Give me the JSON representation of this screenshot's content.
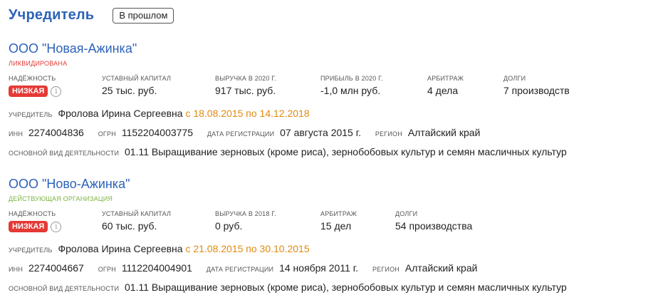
{
  "header": {
    "title": "Учредитель",
    "past_button": "В прошлом"
  },
  "colors": {
    "link": "#2d63b9",
    "liquidated": "#e53935",
    "active": "#7cb342",
    "period": "#e08a10",
    "badge": "#e53935"
  },
  "companies": [
    {
      "name": "ООО \"Новая-Ажинка\"",
      "status": "ЛИКВИДИРОВАНА",
      "metrics": {
        "reliability_label": "НАДЁЖНОСТЬ",
        "reliability_value": "НИЗКАЯ",
        "capital_label": "УСТАВНЫЙ КАПИТАЛ",
        "capital_value": "25 тыс. руб.",
        "revenue_label": "ВЫРУЧКА В 2020 Г.",
        "revenue_value": "917 тыс. руб.",
        "profit_label": "ПРИБЫЛЬ В 2020 Г.",
        "profit_value": "-1,0 млн руб.",
        "arbitration_label": "АРБИТРАЖ",
        "arbitration_value": "4 дела",
        "debts_label": "ДОЛГИ",
        "debts_value": "7 производств"
      },
      "founder_label": "УЧРЕДИТЕЛЬ",
      "founder_name": "Фролова Ирина Сергеевна",
      "founder_period": "с 18.08.2015 по 14.12.2018",
      "inn_label": "ИНН",
      "inn": "2274004836",
      "ogrn_label": "ОГРН",
      "ogrn": "1152204003775",
      "reg_label": "ДАТА РЕГИСТРАЦИИ",
      "reg_date": "07 августа 2015 г.",
      "region_label": "РЕГИОН",
      "region": "Алтайский край",
      "activity_label": "ОСНОВНОЙ ВИД ДЕЯТЕЛЬНОСТИ",
      "activity": "01.11 Выращивание зерновых (кроме риса), зернобобовых культур и семян масличных культур"
    },
    {
      "name": "ООО \"Ново-Ажинка\"",
      "status": "ДЕЙСТВУЮЩАЯ ОРГАНИЗАЦИЯ",
      "metrics": {
        "reliability_label": "НАДЁЖНОСТЬ",
        "reliability_value": "НИЗКАЯ",
        "capital_label": "УСТАВНЫЙ КАПИТАЛ",
        "capital_value": "60 тыс. руб.",
        "revenue_label": "ВЫРУЧКА В 2018 Г.",
        "revenue_value": "0 руб.",
        "arbitration_label": "АРБИТРАЖ",
        "arbitration_value": "15 дел",
        "debts_label": "ДОЛГИ",
        "debts_value": "54 производства"
      },
      "founder_label": "УЧРЕДИТЕЛЬ",
      "founder_name": "Фролова Ирина Сергеевна",
      "founder_period": "с 21.08.2015 по 30.10.2015",
      "inn_label": "ИНН",
      "inn": "2274004667",
      "ogrn_label": "ОГРН",
      "ogrn": "1112204004901",
      "reg_label": "ДАТА РЕГИСТРАЦИИ",
      "reg_date": "14 ноября 2011 г.",
      "region_label": "РЕГИОН",
      "region": "Алтайский край",
      "activity_label": "ОСНОВНОЙ ВИД ДЕЯТЕЛЬНОСТИ",
      "activity": "01.11 Выращивание зерновых (кроме риса), зернобобовых культур и семян масличных культур"
    }
  ]
}
